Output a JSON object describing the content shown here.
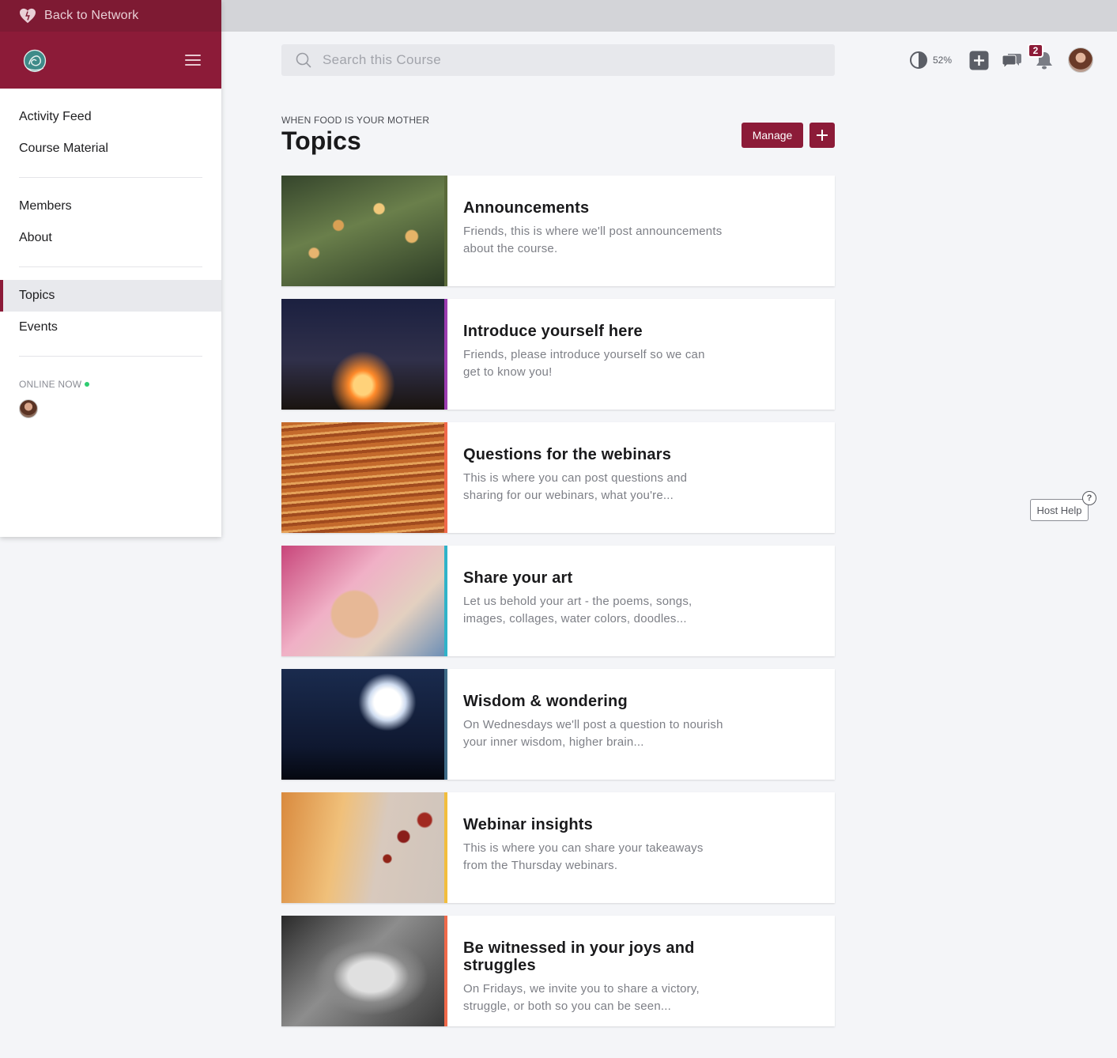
{
  "sidebar": {
    "back_label": "Back to Network",
    "groups": [
      [
        {
          "label": "Activity Feed"
        },
        {
          "label": "Course Material"
        }
      ],
      [
        {
          "label": "Members"
        },
        {
          "label": "About"
        }
      ],
      [
        {
          "label": "Topics",
          "active": true
        },
        {
          "label": "Events"
        }
      ]
    ],
    "online_label": "ONLINE NOW"
  },
  "header": {
    "search_placeholder": "Search this Course",
    "contrast_percent": "52%",
    "notification_count": "2"
  },
  "main": {
    "course_name": "WHEN FOOD IS YOUR MOTHER",
    "title": "Topics",
    "manage_label": "Manage",
    "topics": [
      {
        "title": "Announcements",
        "description": "Friends, this is where we'll post announcements about the course.",
        "accent": "#5a6a3a",
        "thumb": "t1"
      },
      {
        "title": "Introduce yourself here",
        "description": "Friends, please introduce yourself so we can get to know you!",
        "accent": "#9b3bb0",
        "thumb": "t2"
      },
      {
        "title": "Questions for the webinars",
        "description": "This is where you can post questions and sharing for our webinars, what you're...",
        "accent": "#f0694a",
        "thumb": "t3"
      },
      {
        "title": "Share your art",
        "description": "Let us behold your art - the poems, songs, images, collages, water colors, doodles...",
        "accent": "#2fb3c9",
        "thumb": "t4"
      },
      {
        "title": "Wisdom & wondering",
        "description": "On Wednesdays we'll post a question to nourish your inner wisdom, higher brain...",
        "accent": "#3e6a86",
        "thumb": "t5"
      },
      {
        "title": "Webinar insights",
        "description": "This is where you can share your takeaways from the Thursday webinars.",
        "accent": "#f2bd3c",
        "thumb": "t6"
      },
      {
        "title": "Be witnessed in your joys and struggles",
        "description": "On Fridays, we invite you to share a victory, struggle, or both so you can be seen...",
        "accent": "#f0694a",
        "thumb": "t7"
      }
    ]
  },
  "host_help_label": "Host Help",
  "colors": {
    "brand": "#8c1b38",
    "brand_dark": "#7e1a33",
    "online": "#2ecc71"
  }
}
